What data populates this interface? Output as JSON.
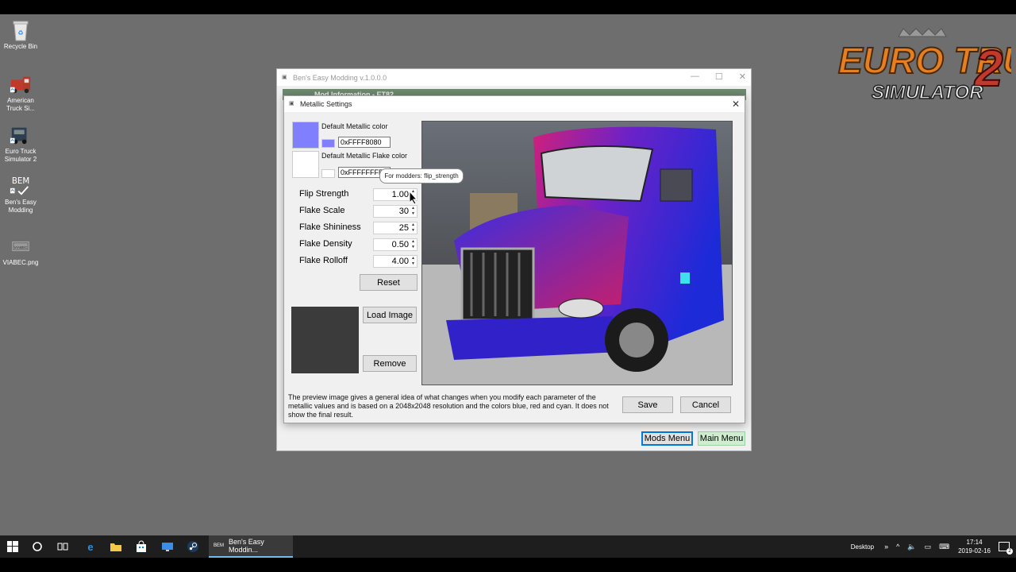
{
  "desktop_icons": [
    {
      "label": "Recycle Bin",
      "icon": "recycle-bin-icon"
    },
    {
      "label": "American Truck Si...",
      "icon": "american-truck-simulator-icon"
    },
    {
      "label": "Euro Truck Simulator 2",
      "icon": "euro-truck-simulator-2-icon"
    },
    {
      "label": "Ben's Easy Modding",
      "icon": "bem-icon"
    },
    {
      "label": "VIABEC.png",
      "icon": "image-file-icon"
    }
  ],
  "ets_logo": {
    "line1": "EURO TRUCK",
    "number": "2",
    "line2": "SIMULATOR"
  },
  "main_window": {
    "title": "Ben's Easy Modding v.1.0.0.0",
    "tab_text": "Mod Information - ET82",
    "mods_menu": "Mods Menu",
    "main_menu": "Main Menu"
  },
  "dialog": {
    "title": "Metallic Settings",
    "metallic_color_label": "Default Metallic color",
    "metallic_color_value": "0xFFFF8080",
    "metallic_color_swatch": "#8080ff",
    "flake_color_label": "Default Metallic Flake color",
    "flake_color_value": "0xFFFFFFFF",
    "flake_color_swatch": "#ffffff",
    "params": [
      {
        "label": "Flip Strength",
        "value": "1.00"
      },
      {
        "label": "Flake Scale",
        "value": "30"
      },
      {
        "label": "Flake Shininess",
        "value": "25"
      },
      {
        "label": "Flake Density",
        "value": "0.50"
      },
      {
        "label": "Flake Rolloff",
        "value": "4.00"
      }
    ],
    "reset": "Reset",
    "load_image": "Load Image",
    "remove": "Remove",
    "description": "The preview image gives a general idea of what changes when you modify each parameter of the metallic values and is based on a 2048x2048 resolution and the colors blue, red and cyan. It does not show the final result.",
    "save": "Save",
    "cancel": "Cancel",
    "tooltip": "For modders: flip_strength"
  },
  "taskbar": {
    "app_label": "Ben's Easy Moddin...",
    "app_icon_text": "BEM",
    "desktop_label": "Desktop",
    "time": "17:14",
    "date": "2019-02-16",
    "accent": "#76b9ed"
  }
}
